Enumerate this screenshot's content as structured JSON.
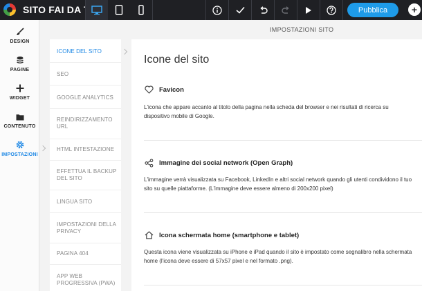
{
  "app": {
    "title": "SITO FAI DA TE"
  },
  "toolbar": {
    "devices": [
      {
        "icon": "desktop-icon",
        "active": true
      },
      {
        "icon": "tablet-icon",
        "active": false
      },
      {
        "icon": "mobile-icon",
        "active": false
      }
    ],
    "tools": [
      "info-icon",
      "check-icon",
      "undo-icon",
      "redo-icon",
      "play-icon",
      "help-icon"
    ],
    "publish_label": "Pubblica",
    "add_icon": "plus-icon"
  },
  "sidebar": {
    "items": [
      {
        "label": "DESIGN",
        "icon": "brush-icon"
      },
      {
        "label": "PAGINE",
        "icon": "pages-icon"
      },
      {
        "label": "WIDGET",
        "icon": "plus-icon"
      },
      {
        "label": "CONTENUTO",
        "icon": "folder-icon"
      },
      {
        "label": "IMPOSTAZIONI",
        "icon": "gear-icon",
        "active": true
      }
    ]
  },
  "settings": {
    "header": "IMPOSTAZIONI SITO",
    "nav": [
      {
        "label": "ICONE DEL SITO",
        "active": true
      },
      {
        "label": "SEO"
      },
      {
        "label": "GOOGLE ANALYTICS"
      },
      {
        "label": "REINDIRIZZAMENTO URL"
      },
      {
        "label": "HTML INTESTAZIONE"
      },
      {
        "label": "EFFETTUA IL BACKUP DEL SITO"
      },
      {
        "label": "LINGUA SITO"
      },
      {
        "label": "IMPOSTAZIONI DELLA PRIVACY"
      },
      {
        "label": "PAGINA 404"
      },
      {
        "label": "APP WEB PROGRESSIVA (PWA)"
      }
    ]
  },
  "content": {
    "title": "Icone del sito",
    "blocks": [
      {
        "icon": "heart-icon",
        "heading": "Favicon",
        "description": "L'icona che appare accanto al titolo della pagina nella scheda del browser e nei risultati di ricerca su dispositivo mobile di Google."
      },
      {
        "icon": "share-icon",
        "heading": "Immagine dei social network (Open Graph)",
        "description": "L'immagine verrà visualizzata su Facebook, LinkedIn e altri social network quando gli utenti condividono il tuo sito su quelle piattaforme. (L'immagine deve essere almeno di 200x200 pixel)"
      },
      {
        "icon": "home-icon",
        "heading": "Icona schermata home (smartphone e tablet)",
        "description": "Questa icona viene visualizzata su iPhone e iPad quando il sito è impostato come segnalibro nella schermata home (l'icona deve essere di 57x57 pixel e nel formato .png)."
      }
    ]
  },
  "colors": {
    "accent": "#1e88e5",
    "topbar": "#1f2024",
    "publish": "#1e9be9"
  }
}
